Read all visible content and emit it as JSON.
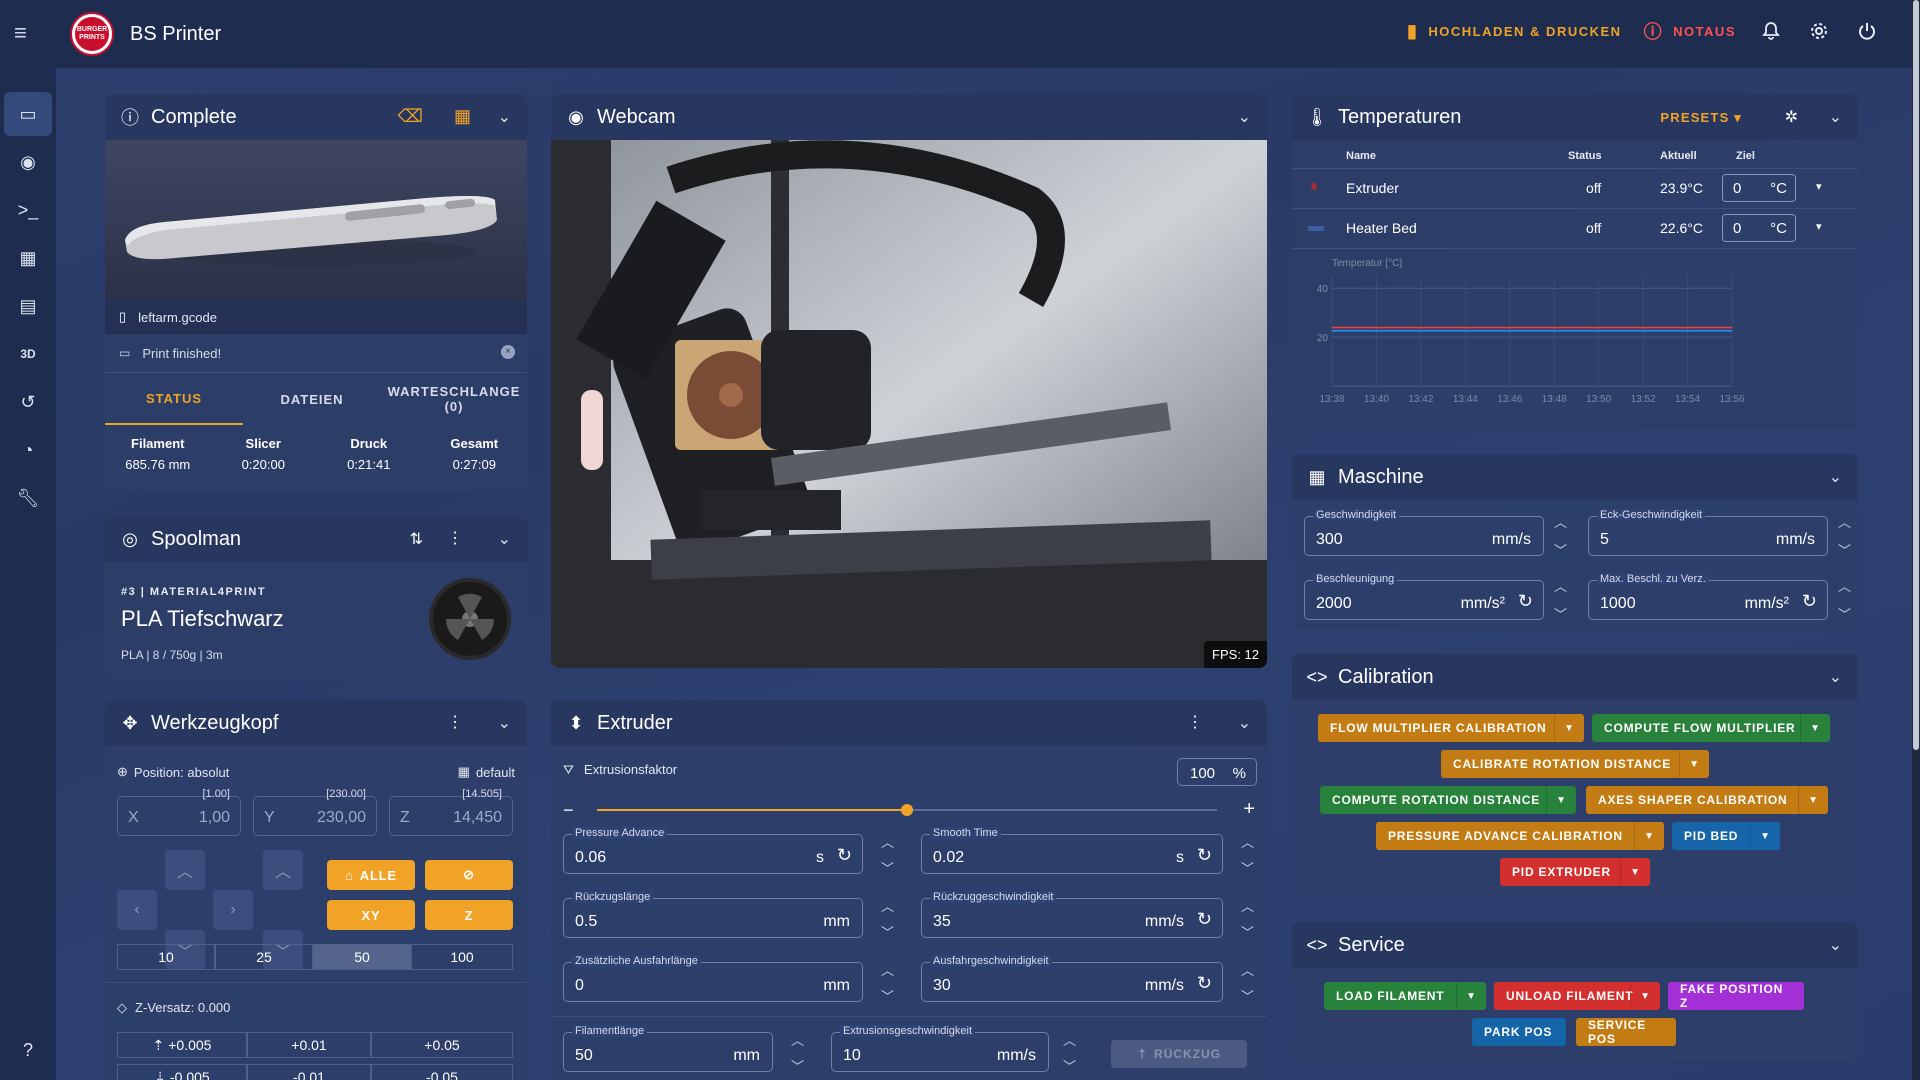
{
  "app": {
    "title": "BS Printer",
    "logo_text": "BURGER PRINTS"
  },
  "topbar": {
    "upload_label": "HOCHLADEN & DRUCKEN",
    "emergency_label": "NOTAUS"
  },
  "sidebar": {
    "items": [
      "dashboard",
      "webcam",
      "console",
      "heightmap",
      "files",
      "3d",
      "history",
      "timelapse",
      "settings"
    ],
    "icon_3d": "3D"
  },
  "status_panel": {
    "title": "Complete",
    "filename": "leftarm.gcode",
    "message": "Print finished!",
    "tabs": [
      "STATUS",
      "DATEIEN",
      "WARTESCHLANGE (0)"
    ],
    "stats": [
      {
        "label": "Filament",
        "value": "685.76 mm"
      },
      {
        "label": "Slicer",
        "value": "0:20:00"
      },
      {
        "label": "Druck",
        "value": "0:21:41"
      },
      {
        "label": "Gesamt",
        "value": "0:27:09"
      }
    ]
  },
  "spoolman": {
    "title": "Spoolman",
    "spool_id": "#3 | MATERIAL4PRINT",
    "name": "PLA Tiefschwarz",
    "details": "PLA | 8 / 750g | 3m"
  },
  "toolhead": {
    "title": "Werkzeugkopf",
    "position_label": "Position: absolut",
    "profile": "default",
    "axes": [
      {
        "name": "X",
        "target": "[1.00]",
        "value": "1,00"
      },
      {
        "name": "Y",
        "target": "[230.00]",
        "value": "230,00"
      },
      {
        "name": "Z",
        "target": "[14.505]",
        "value": "14,450"
      }
    ],
    "home_all": "ALLE",
    "home_xy": "XY",
    "home_z": "Z",
    "steps": [
      "10",
      "25",
      "50",
      "100"
    ],
    "active_step": "50",
    "z_offset_label": "Z-Versatz: 0.000",
    "z_offsets_up": [
      "+0.005",
      "+0.01",
      "+0.05"
    ],
    "z_offsets_down": [
      "-0.005",
      "-0.01",
      "-0.05"
    ]
  },
  "webcam": {
    "title": "Webcam",
    "fps": "FPS: 12"
  },
  "extruder": {
    "title": "Extruder",
    "factor_label": "Extrusionsfaktor",
    "factor_value": "100",
    "factor_unit": "%",
    "factor_fraction": 0.5,
    "fields": [
      {
        "label": "Pressure Advance",
        "value": "0.06",
        "unit": "s"
      },
      {
        "label": "Smooth Time",
        "value": "0.02",
        "unit": "s"
      },
      {
        "label": "Rückzugslänge",
        "value": "0.5",
        "unit": "mm"
      },
      {
        "label": "Rückzuggeschwindigkeit",
        "value": "35",
        "unit": "mm/s"
      },
      {
        "label": "Zusätzliche Ausfahrlänge",
        "value": "0",
        "unit": "mm"
      },
      {
        "label": "Ausfahrgeschwindigkeit",
        "value": "30",
        "unit": "mm/s"
      },
      {
        "label": "Filamentlänge",
        "value": "50",
        "unit": "mm"
      },
      {
        "label": "Extrusionsgeschwindigkeit",
        "value": "10",
        "unit": "mm/s"
      }
    ],
    "retract_label": "RÜCKZUG"
  },
  "temperatures": {
    "title": "Temperaturen",
    "presets_label": "PRESETS",
    "columns": [
      "Name",
      "Status",
      "Aktuell",
      "Ziel"
    ],
    "rows": [
      {
        "name": "Extruder",
        "status": "off",
        "current": "23.9°C",
        "target": "0",
        "unit": "°C"
      },
      {
        "name": "Heater Bed",
        "status": "off",
        "current": "22.6°C",
        "target": "0",
        "unit": "°C"
      }
    ],
    "colors": {
      "extruder": "#f44336",
      "bed": "#2196f3"
    }
  },
  "chart_data": {
    "type": "line",
    "ylabel": "Temperatur [°C]",
    "yticks": [
      "40",
      "20"
    ],
    "ylim": [
      0,
      45
    ],
    "x": [
      "13:38",
      "13:40",
      "13:42",
      "13:44",
      "13:46",
      "13:48",
      "13:50",
      "13:52",
      "13:54",
      "13:56"
    ],
    "series": [
      {
        "name": "Extruder",
        "values": [
          23.9,
          23.9,
          23.9,
          23.9,
          23.9,
          23.9,
          23.9,
          23.9,
          23.9,
          23.9
        ]
      },
      {
        "name": "Heater Bed",
        "values": [
          22.6,
          22.6,
          22.6,
          22.6,
          22.6,
          22.6,
          22.6,
          22.6,
          22.6,
          22.6
        ]
      }
    ]
  },
  "machine": {
    "title": "Maschine",
    "fields": [
      {
        "label": "Geschwindigkeit",
        "value": "300",
        "unit": "mm/s"
      },
      {
        "label": "Eck-Geschwindigkeit",
        "value": "5",
        "unit": "mm/s"
      },
      {
        "label": "Beschleunigung",
        "value": "2000",
        "unit": "mm/s²"
      },
      {
        "label": "Max. Beschl. zu Verz.",
        "value": "1000",
        "unit": "mm/s²"
      }
    ]
  },
  "calibration": {
    "title": "Calibration",
    "buttons": [
      "FLOW MULTIPLIER CALIBRATION",
      "COMPUTE FLOW MULTIPLIER",
      "CALIBRATE ROTATION DISTANCE",
      "COMPUTE ROTATION DISTANCE",
      "AXES SHAPER CALIBRATION",
      "PRESSURE ADVANCE CALIBRATION",
      "PID BED",
      "PID EXTRUDER"
    ]
  },
  "service": {
    "title": "Service",
    "buttons": [
      "LOAD FILAMENT",
      "UNLOAD FILAMENT",
      "FAKE POSITION Z",
      "PARK POS",
      "SERVICE POS"
    ]
  }
}
